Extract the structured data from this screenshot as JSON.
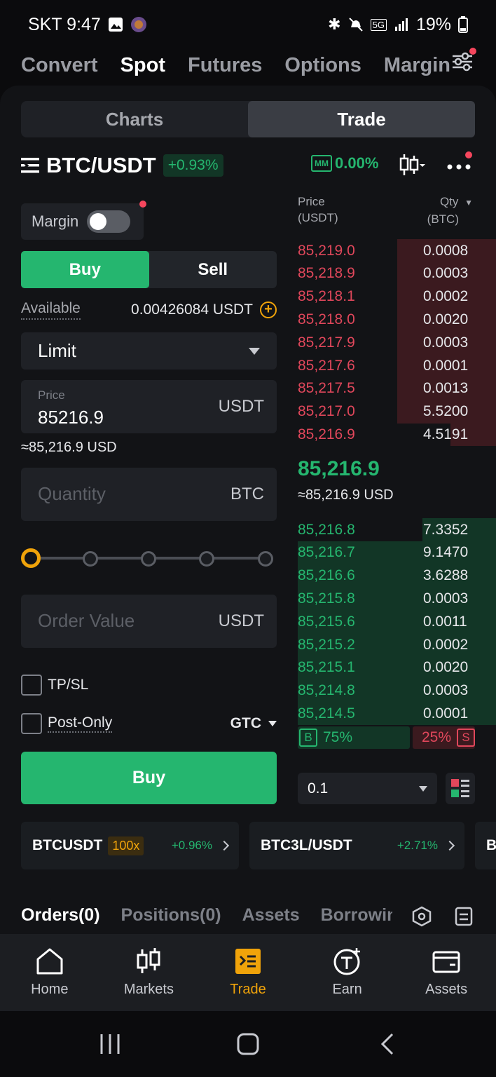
{
  "status_bar": {
    "carrier_time": "SKT 9:47",
    "battery": "19%"
  },
  "product_tabs": [
    "Convert",
    "Spot",
    "Futures",
    "Options",
    "Margin"
  ],
  "view_toggle": {
    "charts": "Charts",
    "trade": "Trade"
  },
  "pair": {
    "name": "BTC/USDT",
    "change": "+0.93%",
    "mm_label": "MM",
    "mm_value": "0.00%"
  },
  "form": {
    "margin_label": "Margin",
    "buy_tab": "Buy",
    "sell_tab": "Sell",
    "available_label": "Available",
    "available_value": "0.00426084 USDT",
    "order_type": "Limit",
    "price_label": "Price",
    "price_value": "85216.9",
    "price_unit": "USDT",
    "price_approx": "≈85,216.9 USD",
    "quantity_placeholder": "Quantity",
    "quantity_unit": "BTC",
    "order_value_placeholder": "Order Value",
    "order_value_unit": "USDT",
    "tpsl_label": "TP/SL",
    "post_only_label": "Post-Only",
    "tif": "GTC",
    "submit": "Buy"
  },
  "orderbook": {
    "price_header": "Price\n(USDT)",
    "qty_header": "Qty\n(BTC)",
    "asks": [
      {
        "price": "85,219.0",
        "qty": "0.0008",
        "depth": 0.5
      },
      {
        "price": "85,218.9",
        "qty": "0.0003",
        "depth": 0.5
      },
      {
        "price": "85,218.1",
        "qty": "0.0002",
        "depth": 0.5
      },
      {
        "price": "85,218.0",
        "qty": "0.0020",
        "depth": 0.5
      },
      {
        "price": "85,217.9",
        "qty": "0.0003",
        "depth": 0.5
      },
      {
        "price": "85,217.6",
        "qty": "0.0001",
        "depth": 0.5
      },
      {
        "price": "85,217.5",
        "qty": "0.0013",
        "depth": 0.5
      },
      {
        "price": "85,217.0",
        "qty": "5.5200",
        "depth": 0.5
      },
      {
        "price": "85,216.9",
        "qty": "4.5191",
        "depth": 0.23
      }
    ],
    "last_price": "85,216.9",
    "last_price_usd": "≈85,216.9 USD",
    "bids": [
      {
        "price": "85,216.8",
        "qty": "7.3352",
        "depth": 0.37
      },
      {
        "price": "85,216.7",
        "qty": "9.1470",
        "depth": 1.0
      },
      {
        "price": "85,216.6",
        "qty": "3.6288",
        "depth": 1.0
      },
      {
        "price": "85,215.8",
        "qty": "0.0003",
        "depth": 1.0
      },
      {
        "price": "85,215.6",
        "qty": "0.0011",
        "depth": 1.0
      },
      {
        "price": "85,215.2",
        "qty": "0.0002",
        "depth": 1.0
      },
      {
        "price": "85,215.1",
        "qty": "0.0020",
        "depth": 1.0
      },
      {
        "price": "85,214.8",
        "qty": "0.0003",
        "depth": 1.0
      },
      {
        "price": "85,214.5",
        "qty": "0.0001",
        "depth": 1.0
      }
    ],
    "buy_ratio": "75%",
    "sell_ratio": "25%",
    "buy_tag": "B",
    "sell_tag": "S",
    "depth_step": "0.1"
  },
  "tickers": [
    {
      "symbol": "BTCUSDT",
      "leverage": "100x",
      "change": "+0.96%"
    },
    {
      "symbol": "BTC3L/USDT",
      "change": "+2.71%"
    },
    {
      "symbol": "B"
    }
  ],
  "orders_tabs": [
    "Orders(0)",
    "Positions(0)",
    "Assets",
    "Borrowing"
  ],
  "bottom_nav": [
    "Home",
    "Markets",
    "Trade",
    "Earn",
    "Assets"
  ],
  "colors": {
    "green": "#25b66f",
    "red": "#e0475b",
    "accent": "#f0a30a"
  }
}
